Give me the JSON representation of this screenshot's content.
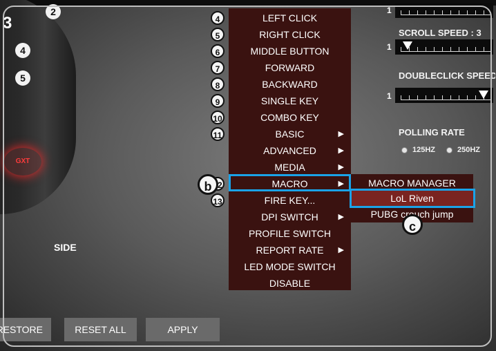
{
  "badges": {
    "step": "3",
    "mouse_buttons": [
      "2",
      "4",
      "5"
    ],
    "logo_text": "GXT",
    "callout_b": "b",
    "callout_c": "c"
  },
  "menu": {
    "numbers": [
      "4",
      "5",
      "6",
      "7",
      "8",
      "9",
      "10",
      "11",
      "12",
      "13"
    ],
    "items": [
      {
        "label": "LEFT CLICK",
        "has_arrow": false
      },
      {
        "label": "RIGHT CLICK",
        "has_arrow": false
      },
      {
        "label": "MIDDLE BUTTON",
        "has_arrow": false
      },
      {
        "label": "FORWARD",
        "has_arrow": false
      },
      {
        "label": "BACKWARD",
        "has_arrow": false
      },
      {
        "label": "SINGLE KEY",
        "has_arrow": false
      },
      {
        "label": "COMBO KEY",
        "has_arrow": false
      },
      {
        "label": "BASIC",
        "has_arrow": true
      },
      {
        "label": "ADVANCED",
        "has_arrow": true
      },
      {
        "label": "MEDIA",
        "has_arrow": true
      },
      {
        "label": "MACRO",
        "has_arrow": true
      },
      {
        "label": "FIRE KEY...",
        "has_arrow": false
      },
      {
        "label": "DPI SWITCH",
        "has_arrow": true
      },
      {
        "label": "PROFILE SWITCH",
        "has_arrow": false
      },
      {
        "label": "REPORT RATE",
        "has_arrow": true
      },
      {
        "label": "LED MODE SWITCH",
        "has_arrow": false
      },
      {
        "label": "DISABLE",
        "has_arrow": false
      }
    ],
    "arrow_glyph": "▶"
  },
  "submenu": {
    "items": [
      "MACRO MANAGER",
      "LoL Riven",
      "PUBG crouch jump"
    ],
    "selected_index": 1
  },
  "settings": {
    "scroll_speed_title": "SCROLL SPEED : 3",
    "scroll_speed_min": "1",
    "doubleclick_title": "DOUBLECLICK SPEED",
    "doubleclick_min": "1",
    "top_slider_min": "1",
    "polling_rate_title": "POLLING RATE",
    "polling_options": [
      "125HZ",
      "250HZ"
    ]
  },
  "side_label": "SIDE",
  "buttons": {
    "restore": "RESTORE",
    "reset_all": "RESET ALL",
    "apply": "APPLY"
  },
  "colors": {
    "menu_bg": "#3a1210",
    "highlight_border": "#1aa3e8",
    "selected_bg": "#7a2420",
    "button_bg": "#6a6a6a"
  }
}
